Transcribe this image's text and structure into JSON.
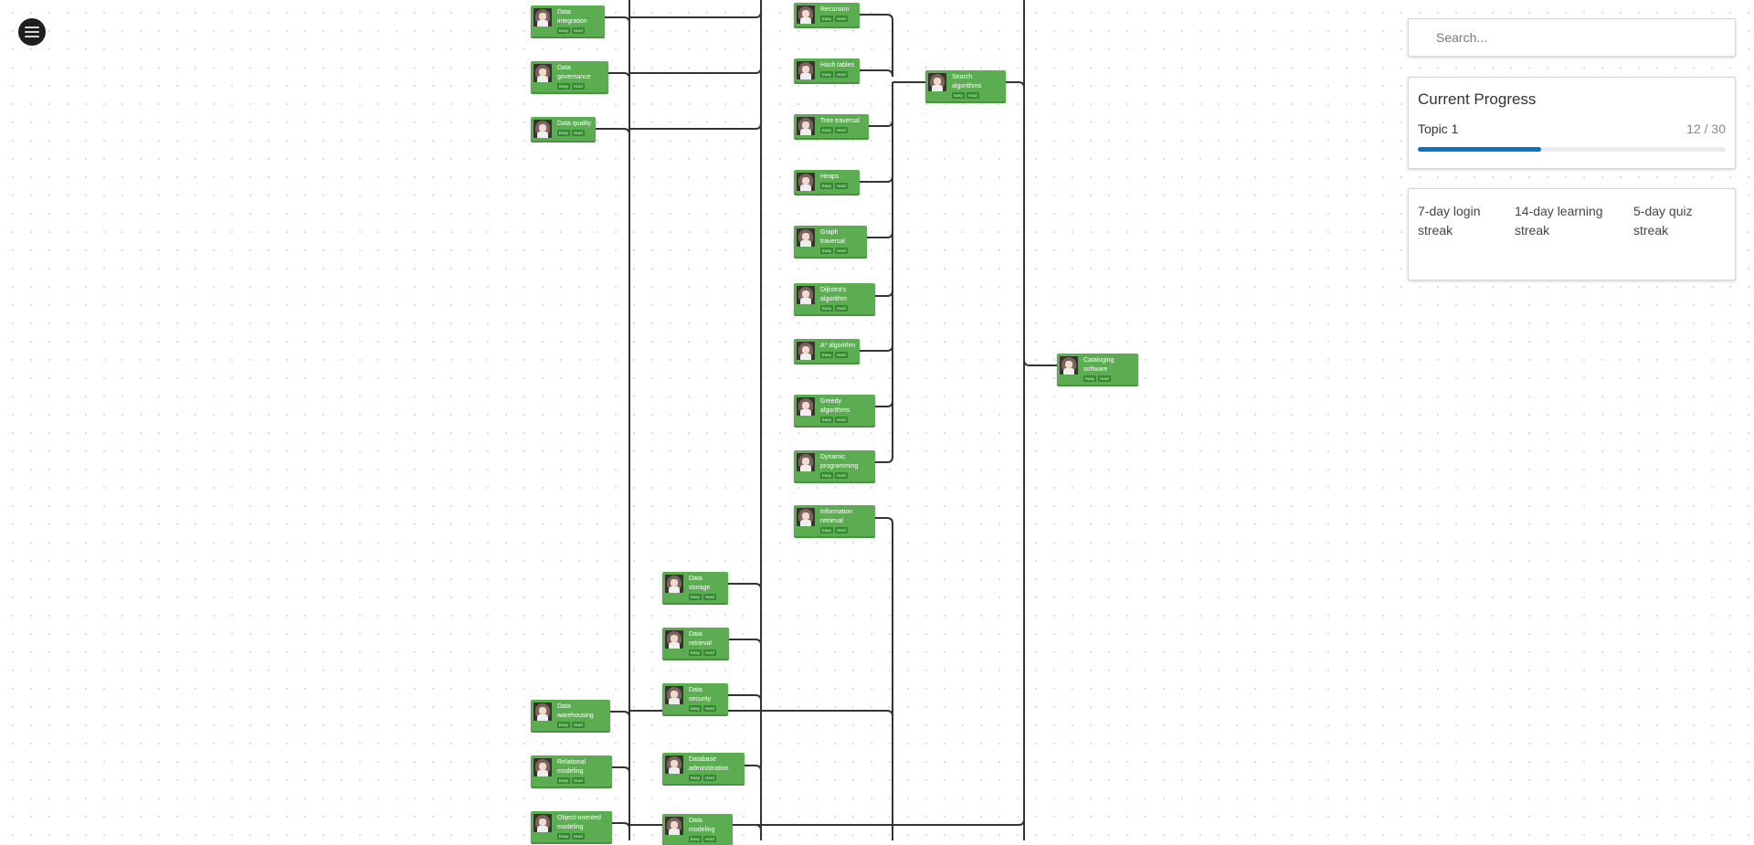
{
  "menu": {
    "icon": "hamburger-menu-icon"
  },
  "search": {
    "placeholder": "Search...",
    "value": ""
  },
  "progress": {
    "title": "Current Progress",
    "topic": "Topic 1",
    "completed": 12,
    "total": 30,
    "count_label": "12 / 30",
    "fraction": 0.4,
    "bar_color": "#0a74c2"
  },
  "streaks": [
    {
      "label": "7-day login streak"
    },
    {
      "label": "14-day learning streak"
    },
    {
      "label": "5-day quiz streak"
    }
  ],
  "colors": {
    "node": "#5cac52",
    "badge": "#2f8a2a",
    "edge": "#333333"
  },
  "difficulty_badges": {
    "easy": "Easy",
    "hard": "Hard"
  },
  "nodes": [
    {
      "id": "data-integration",
      "title": "Data integration"
    },
    {
      "id": "data-governance",
      "title": "Data governance"
    },
    {
      "id": "data-quality",
      "title": "Data quality"
    },
    {
      "id": "data-warehousing",
      "title": "Data warehousing"
    },
    {
      "id": "relational-modeling",
      "title": "Relational modeling"
    },
    {
      "id": "object-oriented-modeling",
      "title": "Object-oriented modeling"
    },
    {
      "id": "data-storage",
      "title": "Data storage"
    },
    {
      "id": "data-retrieval",
      "title": "Data retrieval"
    },
    {
      "id": "data-security",
      "title": "Data security"
    },
    {
      "id": "database-administration",
      "title": "Database administration"
    },
    {
      "id": "data-modeling",
      "title": "Data modeling"
    },
    {
      "id": "recursion",
      "title": "Recursion"
    },
    {
      "id": "hash-tables",
      "title": "Hash tables"
    },
    {
      "id": "tree-traversal",
      "title": "Tree traversal"
    },
    {
      "id": "heaps",
      "title": "Heaps"
    },
    {
      "id": "graph-traversal",
      "title": "Graph traversal"
    },
    {
      "id": "dijkstras-algorithm",
      "title": "Dijkstra's algorithm"
    },
    {
      "id": "a-star-algorithm",
      "title": "A* algorithm"
    },
    {
      "id": "greedy-algorithms",
      "title": "Greedy algorithms"
    },
    {
      "id": "dynamic-programming",
      "title": "Dynamic programming"
    },
    {
      "id": "information-retrieval",
      "title": "Information retrieval"
    },
    {
      "id": "search-algorithms",
      "title": "Search algorithms"
    },
    {
      "id": "cataloging-software",
      "title": "Cataloging software"
    }
  ]
}
